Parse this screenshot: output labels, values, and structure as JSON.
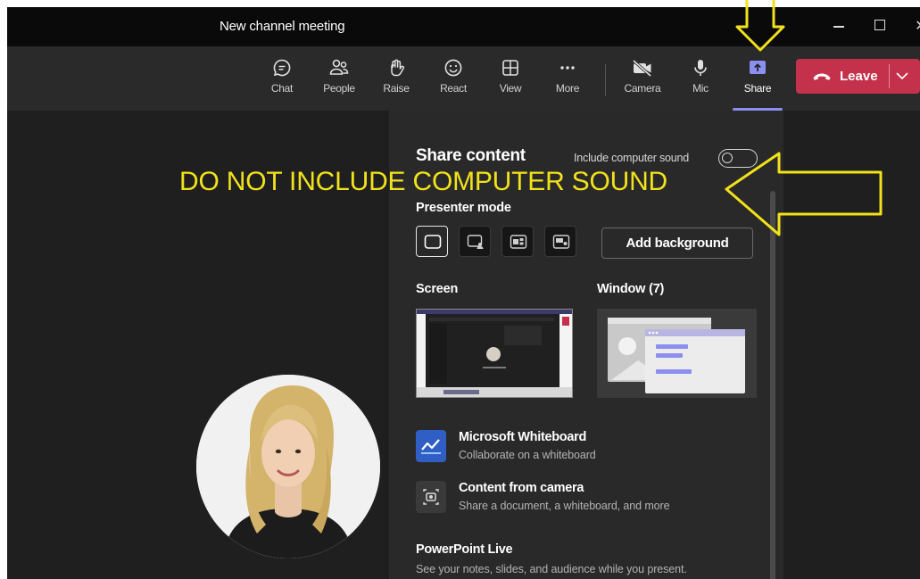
{
  "window": {
    "title": "New channel meeting"
  },
  "toolbar": {
    "items": [
      {
        "label": "Chat",
        "icon": "chat-icon"
      },
      {
        "label": "People",
        "icon": "people-icon"
      },
      {
        "label": "Raise",
        "icon": "raise-hand-icon"
      },
      {
        "label": "React",
        "icon": "react-smiley-icon"
      },
      {
        "label": "View",
        "icon": "view-grid-icon"
      },
      {
        "label": "More",
        "icon": "more-ellipsis-icon"
      },
      {
        "label": "Camera",
        "icon": "camera-off-icon"
      },
      {
        "label": "Mic",
        "icon": "mic-icon"
      },
      {
        "label": "Share",
        "icon": "share-tray-icon"
      }
    ],
    "leave_label": "Leave",
    "leave_color": "#c4314b",
    "active_accent": "#8b8ff0"
  },
  "share_panel": {
    "title": "Share content",
    "sound_label": "Include computer sound",
    "sound_enabled": false,
    "presenter_mode_label": "Presenter mode",
    "add_background_label": "Add background",
    "screen_label": "Screen",
    "window_label": "Window (7)",
    "whiteboard": {
      "title": "Microsoft Whiteboard",
      "subtitle": "Collaborate on a whiteboard"
    },
    "camera_content": {
      "title": "Content from camera",
      "subtitle": "Share a document, a whiteboard, and more"
    },
    "powerpoint": {
      "title": "PowerPoint Live",
      "subtitle": "See your notes, slides, and audience while you present."
    }
  },
  "annotation": {
    "text": "DO NOT INCLUDE COMPUTER SOUND",
    "color": "#f2e21b"
  }
}
